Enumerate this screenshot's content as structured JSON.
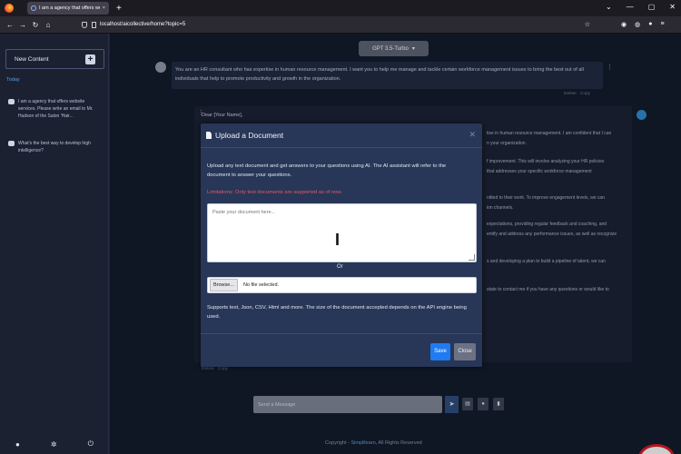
{
  "browser": {
    "tab_title": "I am a agency that offers website",
    "tab_close": "×",
    "new_tab": "+",
    "url": "localhost/aicollective/home?topic=5",
    "controls": {
      "chevron": "⌄",
      "minimize": "—",
      "maximize": "▢",
      "close": "✕"
    },
    "nav": {
      "back": "←",
      "forward": "→",
      "reload": "↻",
      "home": "⌂"
    },
    "bookmark": "☆",
    "toolbar": {
      "pocket": "◉",
      "account": "◍",
      "extension": "●",
      "menu": "≡"
    }
  },
  "sidebar": {
    "new_content_label": "New Content",
    "plus": "+",
    "section": "Today",
    "items": [
      {
        "text": "I am a agency that offers website services. Please write an email to Mr. Hudson of the Salon 'Hair..."
      },
      {
        "text": "What's the best way to develop high intelligence?"
      }
    ],
    "bottom": {
      "user": "●",
      "settings": "✲",
      "power": "⏻"
    }
  },
  "main": {
    "model_selector": "GPT 3.5-Turbo",
    "model_caret": "▾",
    "user_message": "You are an HR consultant who has expertise in human resource management. I want you to help me manage and tackle certain workforce management issues to bring the best out of all individuals that help to promote productivity and growth in the organization.",
    "kebab": "⋮",
    "delete_label": "Delete",
    "copy_label": "Copy",
    "ai_greeting": "Dear [Your Name],",
    "ai_fragments": [
      "tise in human resource management. I am confident that I can",
      "n your organization.",
      "f improvement. This will involve analyzing your HR policies",
      "that addresses your specific workforce management",
      "nitted to their work. To improve engagement levels, we can",
      "ion channels.",
      "expectations, providing regular feedback and coaching, and",
      "entify and address any performance issues, as well as recognize",
      "s and developing a plan to build a pipeline of talent, we can",
      "state to contact me if you have any questions or would like to"
    ],
    "composer_placeholder": "Send a Message",
    "send_icon": "➤",
    "footer_prefix": "Copyright - ",
    "footer_link": "Simplilearn",
    "footer_suffix": ", All Rights Reserved"
  },
  "modal": {
    "title": "Upload a Document",
    "close": "✕",
    "description": "Upload any text document and get answers to your questions using AI. The AI assistant will refer to the document to answer your questions.",
    "limitation": "Limitations: Only text documents are supported as of now.",
    "textarea_placeholder": "Paste your document here...",
    "or_label": "Or",
    "browse_label": "Browse...",
    "no_file": "No file selected.",
    "support_text": "Supports text, Json, CSV, Html and more. The size of the document accepted depends on the API engine being used.",
    "save_label": "Save",
    "close_label": "Close"
  }
}
